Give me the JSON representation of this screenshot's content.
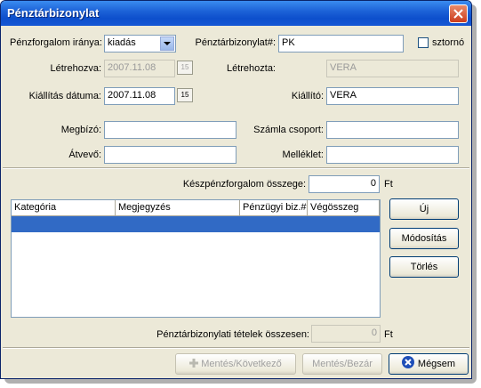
{
  "window": {
    "title": "Pénztárbizonylat"
  },
  "form": {
    "direction_label": "Pénzforgalom iránya:",
    "direction_value": "kiadás",
    "voucher_no_label": "Pénztárbizonylat#:",
    "voucher_no_value": "PK",
    "storno_label": "sztornó",
    "created_label": "Létrehozva:",
    "created_value": "2007.11.08",
    "created_by_label": "Létrehozta:",
    "created_by_value": "VERA",
    "issue_date_label": "Kiállítás dátuma:",
    "issue_date_value": "2007.11.08",
    "issuer_label": "Kiállító:",
    "issuer_value": "VERA",
    "principal_label": "Megbízó:",
    "principal_value": "",
    "invoice_group_label": "Számla csoport:",
    "invoice_group_value": "",
    "recipient_label": "Átvevő:",
    "recipient_value": "",
    "attachment_label": "Melléklet:",
    "attachment_value": "",
    "calendar_glyph": "15"
  },
  "cash": {
    "amount_label": "Készpénzforgalom összege:",
    "amount_value": "0",
    "currency": "Ft"
  },
  "table": {
    "columns": [
      "Kategória",
      "Megjegyzés",
      "Pénzügyi biz.#",
      "Végösszeg"
    ]
  },
  "side_buttons": {
    "new_label": "Új",
    "modify_label": "Módosítás",
    "delete_label": "Törlés"
  },
  "totals": {
    "label": "Pénztárbizonylati tételek összesen:",
    "value": "0",
    "currency": "Ft"
  },
  "footer": {
    "save_next_label": "Mentés/Következő",
    "save_close_label": "Mentés/Bezár",
    "cancel_label": "Mégsem"
  },
  "colors": {
    "title_bar": "#1d63d8",
    "selection": "#316ac5",
    "window_bg": "#ece9d8"
  }
}
